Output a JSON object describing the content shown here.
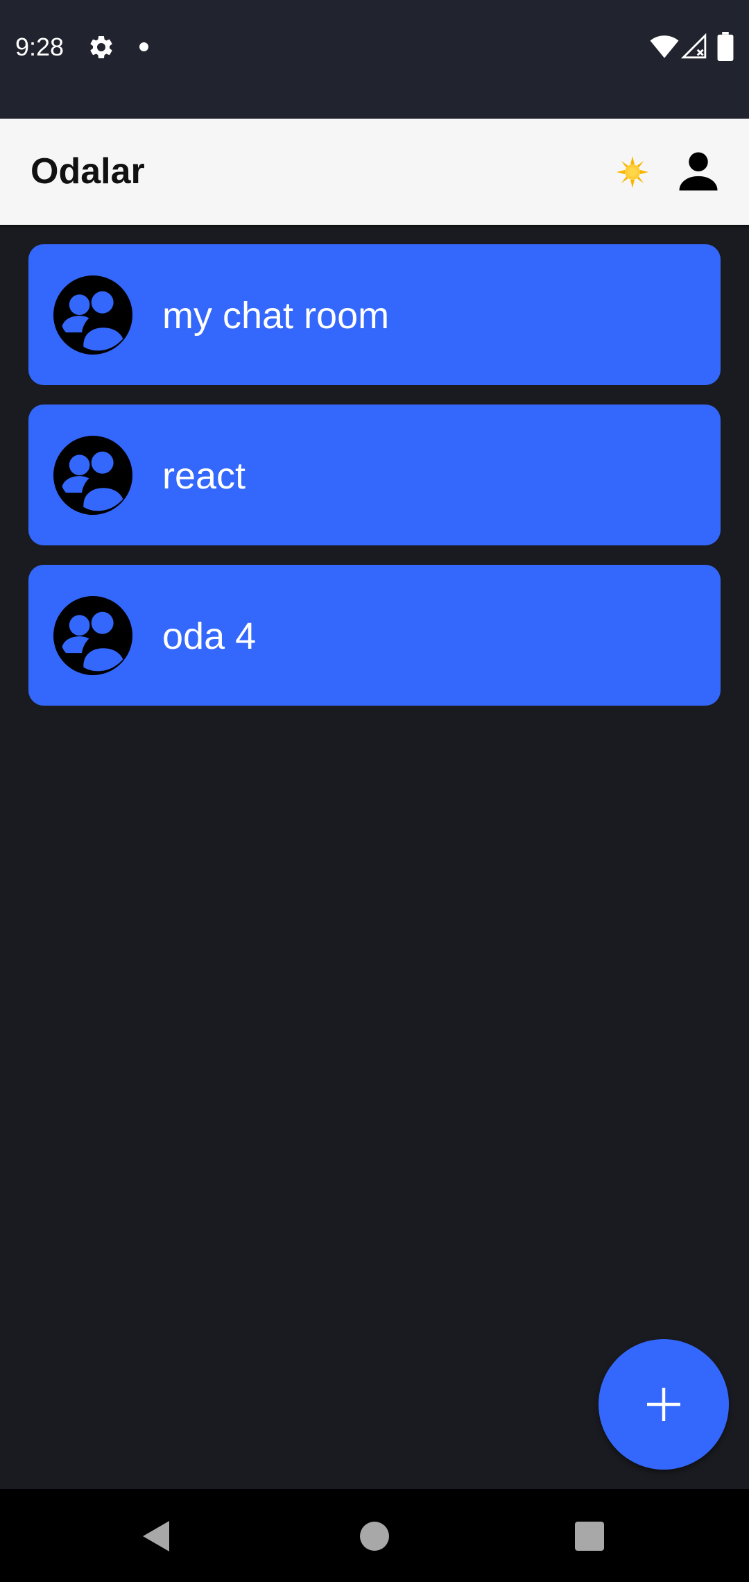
{
  "status_bar": {
    "time": "9:28",
    "icons": [
      "gear-icon",
      "notification-dot",
      "wifi-icon",
      "signal-icon",
      "battery-icon"
    ]
  },
  "app_bar": {
    "title": "Odalar",
    "theme_icon": "sun-icon",
    "profile_icon": "person-icon"
  },
  "rooms": [
    {
      "name": "my chat room",
      "icon": "group-icon"
    },
    {
      "name": "react",
      "icon": "group-icon"
    },
    {
      "name": "oda 4",
      "icon": "group-icon"
    }
  ],
  "fab": {
    "icon": "plus-icon"
  },
  "nav_bar": {
    "icons": [
      "back-icon",
      "home-icon",
      "recents-icon"
    ]
  },
  "colors": {
    "background": "#1a1b20",
    "status_bar": "#21232e",
    "app_bar": "#f6f6f6",
    "accent": "#3467fb"
  }
}
